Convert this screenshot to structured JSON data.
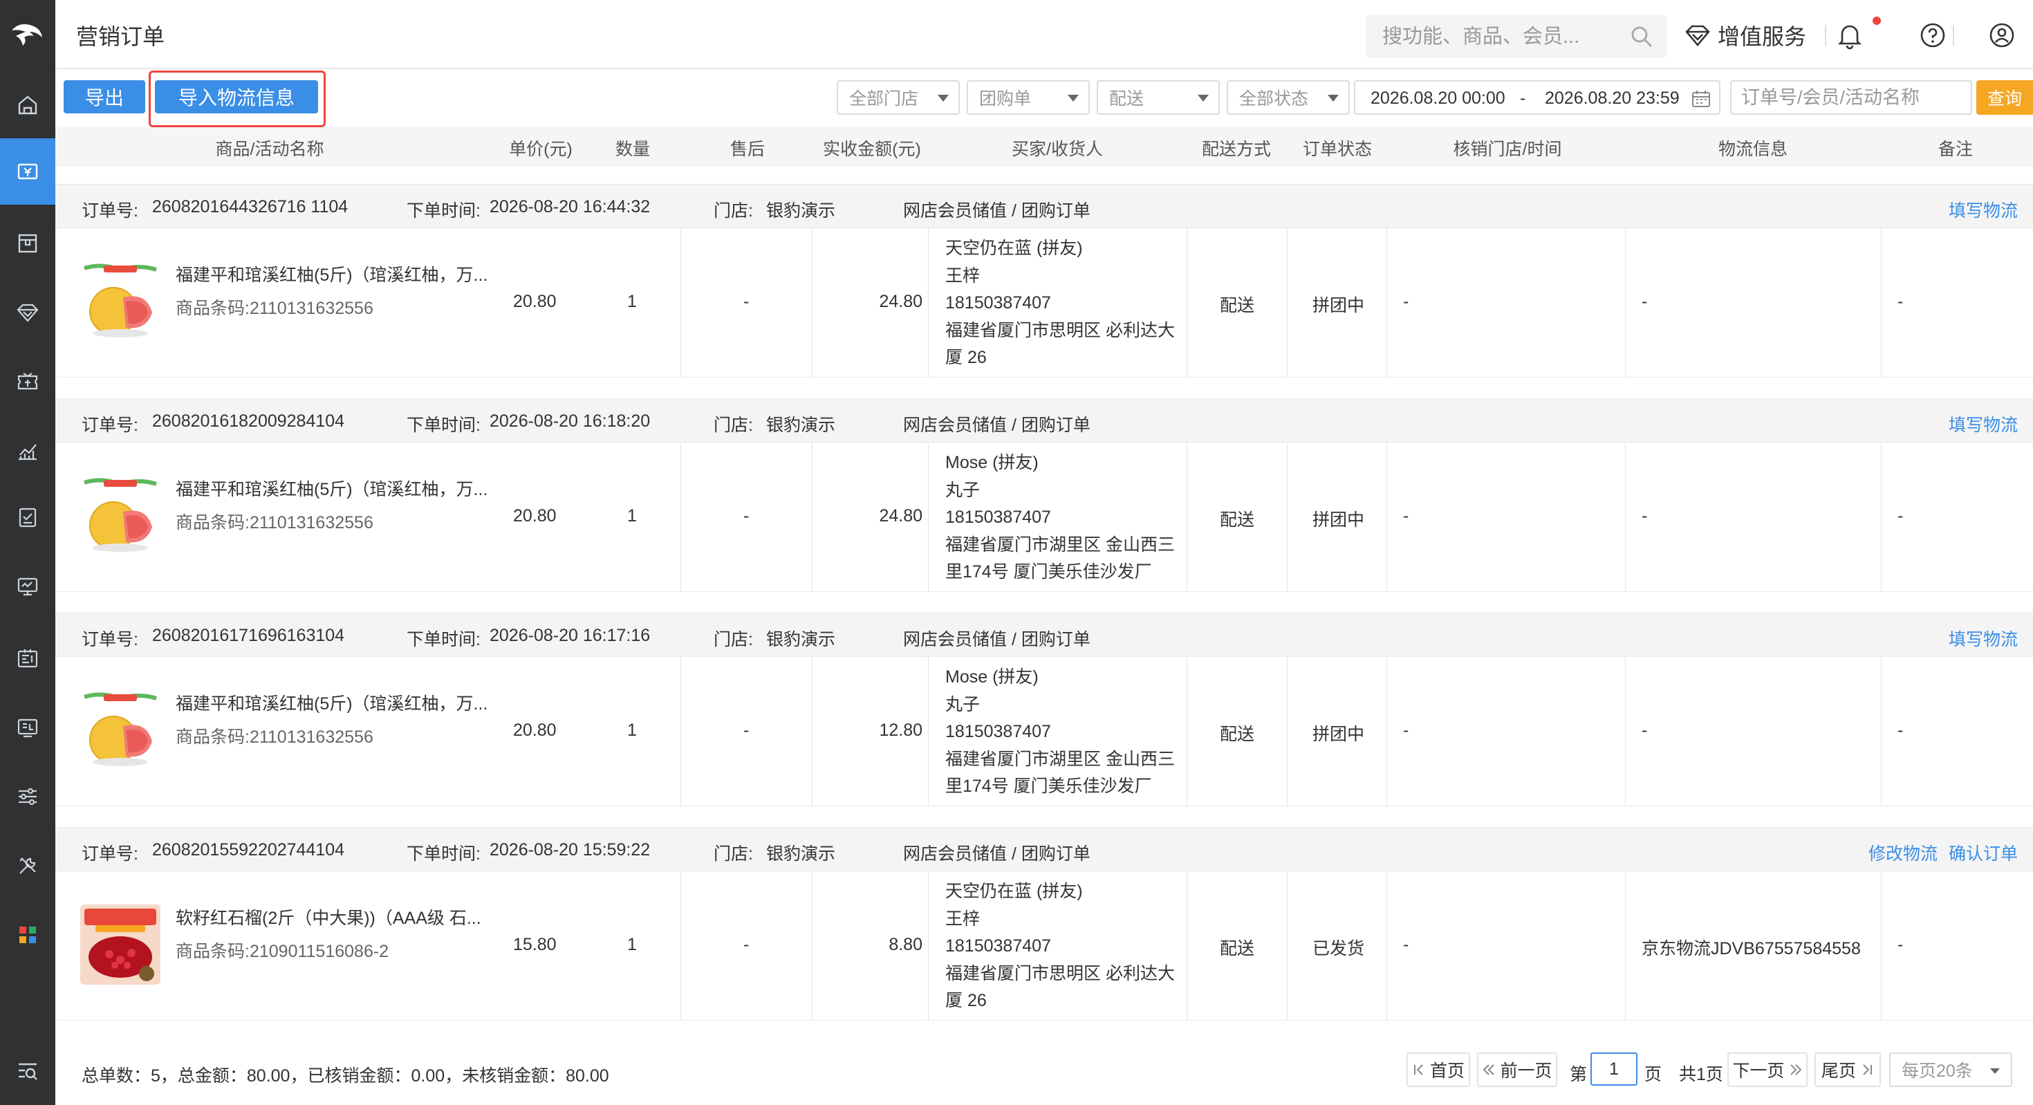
{
  "header": {
    "title": "营销订单",
    "search_placeholder": "搜功能、商品、会员...",
    "value_added_service": "增值服务"
  },
  "toolbar": {
    "export_label": "导出",
    "import_logistics_label": "导入物流信息",
    "filters": {
      "store": "全部门店",
      "order_type": "团购单",
      "delivery": "配送",
      "status": "全部状态"
    },
    "date_start": "2026.08.20 00:00",
    "date_sep": "-",
    "date_end": "2026.08.20 23:59",
    "order_search_placeholder": "订单号/会员/活动名称",
    "query_label": "查询"
  },
  "columns": [
    "商品/活动名称",
    "单价(元)",
    "数量",
    "售后",
    "实收金额(元)",
    "买家/收货人",
    "配送方式",
    "订单状态",
    "核销门店/时间",
    "物流信息",
    "备注"
  ],
  "labels": {
    "order_no": "订单号:",
    "order_time": "下单时间:",
    "store": "门店:",
    "product_code": "商品条码:"
  },
  "orders": [
    {
      "order_no": "2608201644326716 1104",
      "order_time": "2026-08-20 16:44:32",
      "store": "银豹演示",
      "source": "网店会员储值 / 团购订单",
      "actions": [
        "填写物流"
      ],
      "product_name": "福建平和琯溪红柚(5斤)（琯溪红柚，万...",
      "product_code": "2110131632556",
      "unit_price": "20.80",
      "quantity": "1",
      "after_sale": "-",
      "amount": "24.80",
      "buyer": [
        "天空仍在蓝 (拼友)",
        "王梓",
        "18150387407",
        "福建省厦门市思明区 必利达大",
        "厦 26"
      ],
      "delivery": "配送",
      "status": "拼团中",
      "verify": "-",
      "logistics": "-",
      "remark": "-",
      "image": "pomelo"
    },
    {
      "order_no": "26082016182009284104",
      "order_time": "2026-08-20 16:18:20",
      "store": "银豹演示",
      "source": "网店会员储值 / 团购订单",
      "actions": [
        "填写物流"
      ],
      "product_name": "福建平和琯溪红柚(5斤)（琯溪红柚，万...",
      "product_code": "2110131632556",
      "unit_price": "20.80",
      "quantity": "1",
      "after_sale": "-",
      "amount": "24.80",
      "buyer": [
        "Mose (拼友)",
        "丸子",
        "18150387407",
        "福建省厦门市湖里区 金山西三",
        "里174号 厦门美乐佳沙发厂"
      ],
      "delivery": "配送",
      "status": "拼团中",
      "verify": "-",
      "logistics": "-",
      "remark": "-",
      "image": "pomelo"
    },
    {
      "order_no": "26082016171696163104",
      "order_time": "2026-08-20 16:17:16",
      "store": "银豹演示",
      "source": "网店会员储值 / 团购订单",
      "actions": [
        "填写物流"
      ],
      "product_name": "福建平和琯溪红柚(5斤)（琯溪红柚，万...",
      "product_code": "2110131632556",
      "unit_price": "20.80",
      "quantity": "1",
      "after_sale": "-",
      "amount": "12.80",
      "buyer": [
        "Mose (拼友)",
        "丸子",
        "18150387407",
        "福建省厦门市湖里区 金山西三",
        "里174号 厦门美乐佳沙发厂"
      ],
      "delivery": "配送",
      "status": "拼团中",
      "verify": "-",
      "logistics": "-",
      "remark": "-",
      "image": "pomelo"
    },
    {
      "order_no": "26082015592202744104",
      "order_time": "2026-08-20 15:59:22",
      "store": "银豹演示",
      "source": "网店会员储值 / 团购订单",
      "actions": [
        "修改物流",
        "确认订单"
      ],
      "product_name": "软籽红石榴(2斤（中大果))（AAA级 石...",
      "product_code": "2109011516086-2",
      "unit_price": "15.80",
      "quantity": "1",
      "after_sale": "-",
      "amount": "8.80",
      "buyer": [
        "天空仍在蓝 (拼友)",
        "王梓",
        "18150387407",
        "福建省厦门市思明区 必利达大",
        "厦 26"
      ],
      "delivery": "配送",
      "status": "已发货",
      "verify": "-",
      "logistics": "京东物流JDVB67557584558",
      "remark": "-",
      "image": "pomegranate"
    }
  ],
  "footer": {
    "summary": "总单数：5，总金额：80.00，已核销金额：0.00，未核销金额：80.00",
    "first": "首页",
    "prev": "前一页",
    "page_prefix": "第",
    "current_page": "1",
    "page_suffix": "页",
    "total_pages": "共1页",
    "next": "下一页",
    "last": "尾页",
    "per_page": "每页20条"
  },
  "colors": {
    "primary": "#3a8ee6",
    "query": "#f5a623",
    "highlight": "#f0433d",
    "sidebar": "#2f3133"
  }
}
